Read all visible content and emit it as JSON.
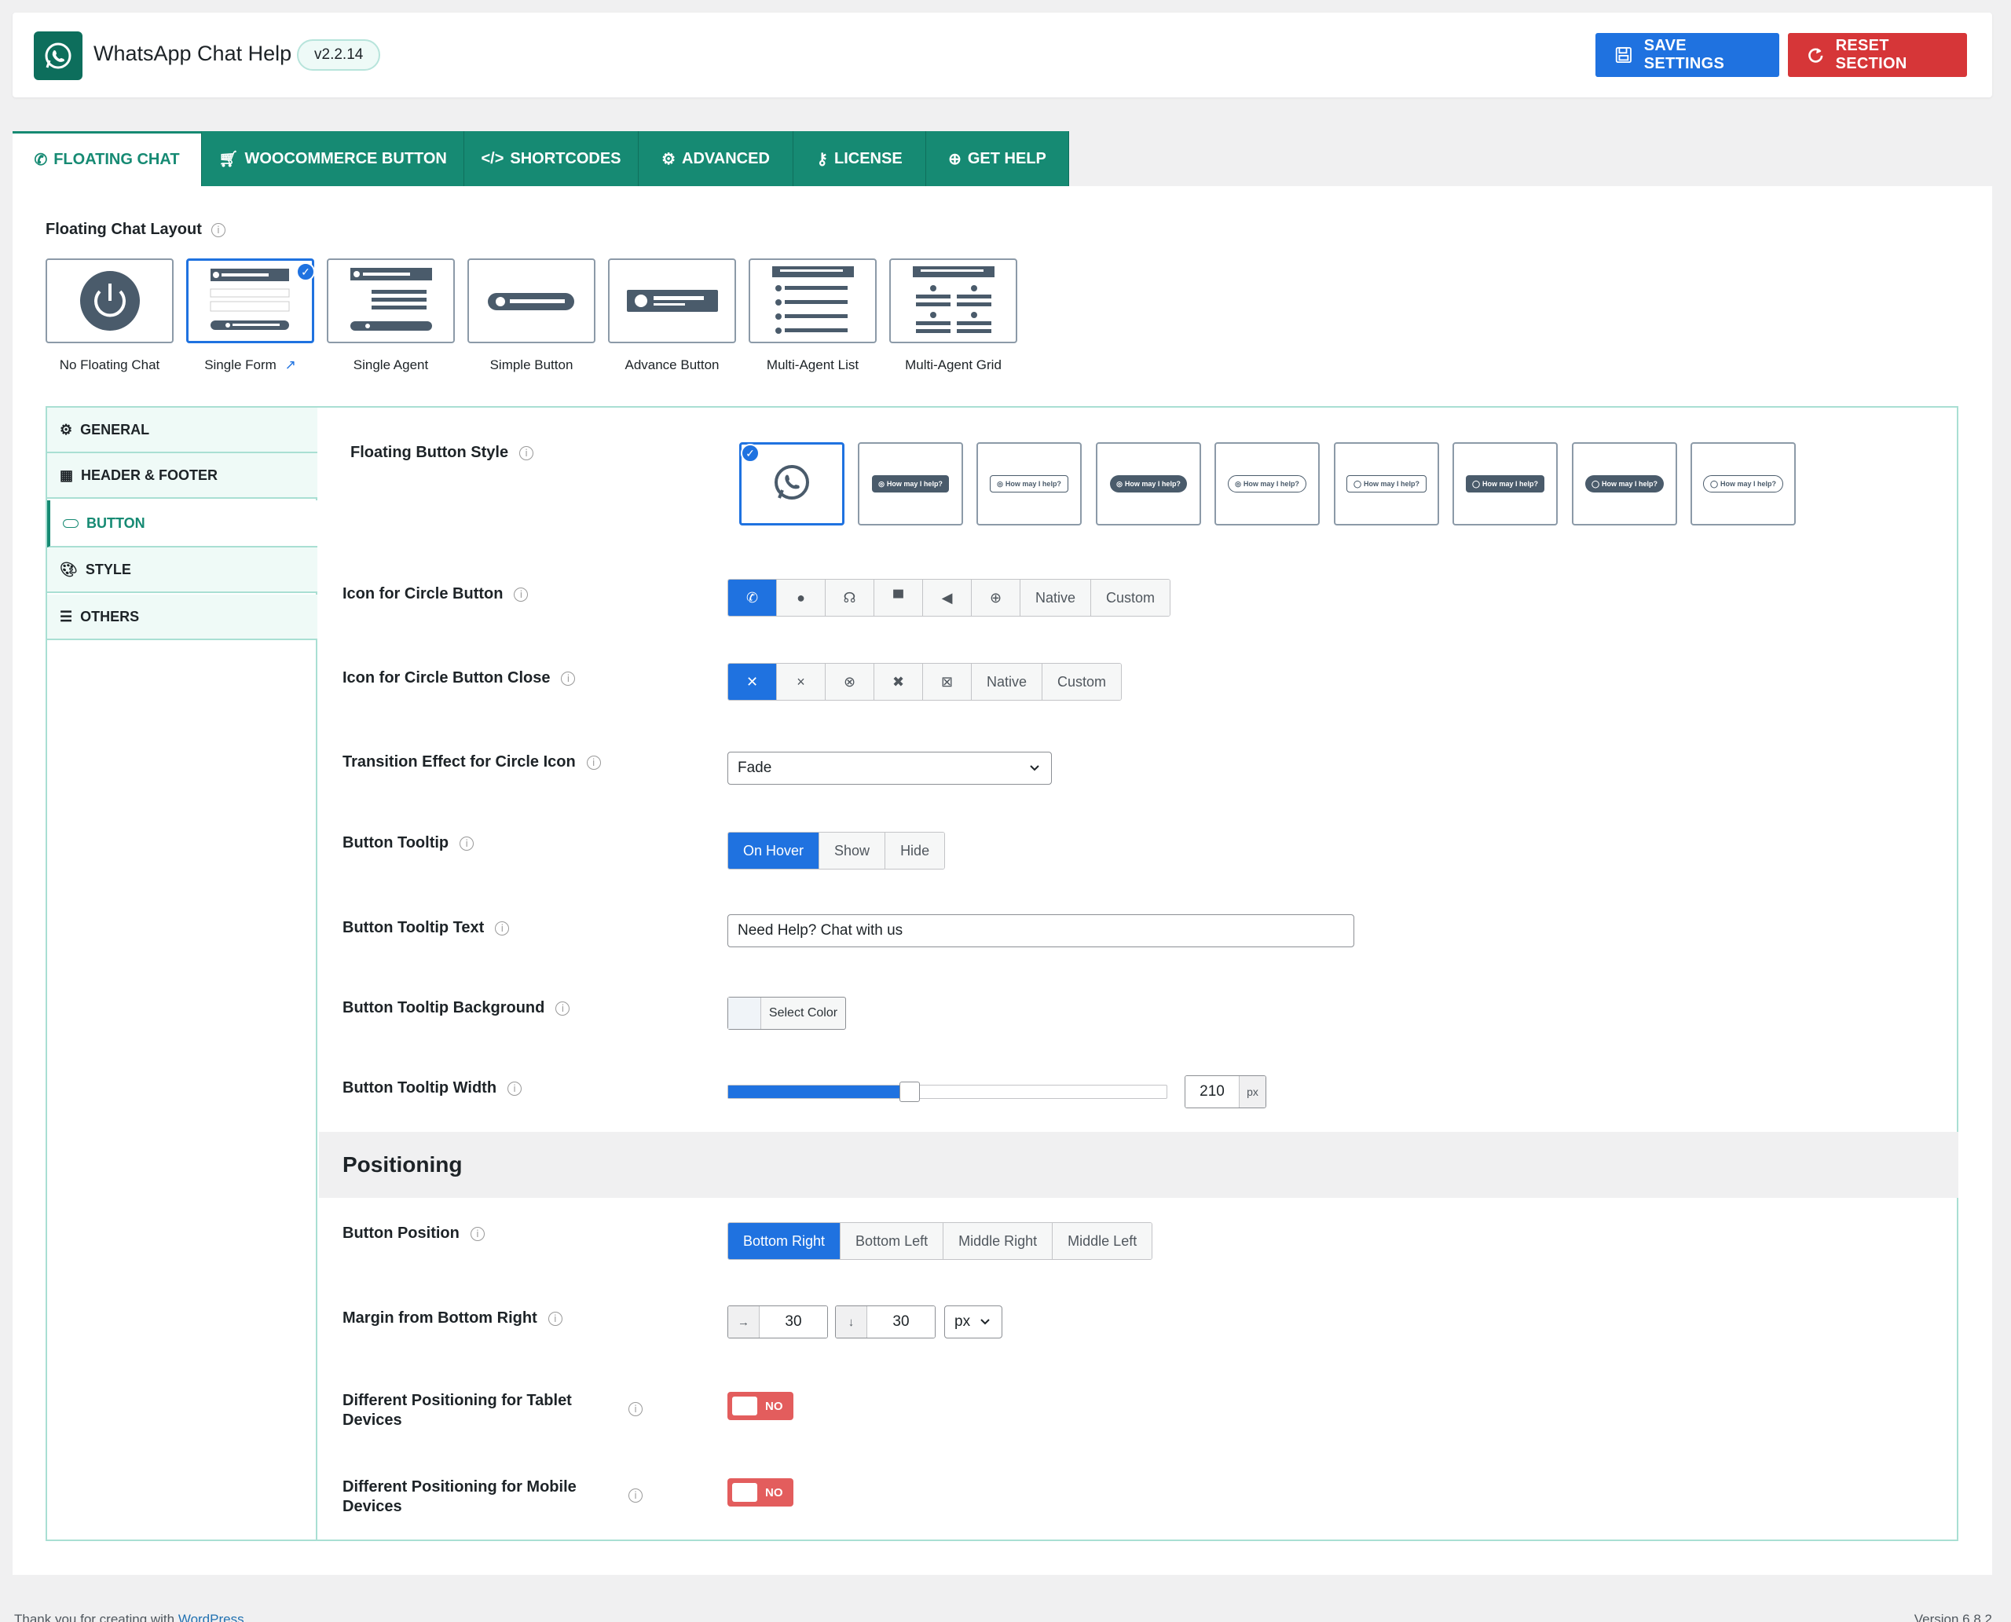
{
  "header": {
    "app_title": "WhatsApp Chat Help",
    "version": "v2.2.14",
    "save_label": "SAVE SETTINGS",
    "reset_label": "RESET SECTION",
    "save_color": "#1f72e0",
    "reset_color": "#d63638"
  },
  "tabs": [
    {
      "label": "FLOATING CHAT",
      "icon": "whatsapp-icon",
      "active": true
    },
    {
      "label": "WOOCOMMERCE BUTTON",
      "icon": "cart-icon"
    },
    {
      "label": "SHORTCODES",
      "icon": "code-icon"
    },
    {
      "label": "ADVANCED",
      "icon": "gears-icon"
    },
    {
      "label": "LICENSE",
      "icon": "key-icon"
    },
    {
      "label": "GET HELP",
      "icon": "lifebuoy-icon"
    }
  ],
  "layout": {
    "label": "Floating Chat Layout",
    "options": [
      {
        "name": "No Floating Chat"
      },
      {
        "name": "Single Form",
        "selected": true
      },
      {
        "name": "Single Agent"
      },
      {
        "name": "Simple Button"
      },
      {
        "name": "Advance Button"
      },
      {
        "name": "Multi-Agent List"
      },
      {
        "name": "Multi-Agent Grid"
      }
    ]
  },
  "sidebar": {
    "items": [
      {
        "label": "GENERAL",
        "icon": "gears-icon"
      },
      {
        "label": "HEADER & FOOTER",
        "icon": "table-icon"
      },
      {
        "label": "BUTTON",
        "icon": "button-shape-icon",
        "active": true
      },
      {
        "label": "STYLE",
        "icon": "palette-icon"
      },
      {
        "label": "OTHERS",
        "icon": "sliders-icon"
      }
    ]
  },
  "button_settings": {
    "floating_button_style": {
      "label": "Floating Button Style",
      "pill_text": "How may I help?"
    },
    "circle_icon": {
      "label": "Icon for Circle Button",
      "native": "Native",
      "custom": "Custom"
    },
    "circle_close": {
      "label": "Icon for Circle Button Close",
      "native": "Native",
      "custom": "Custom"
    },
    "transition": {
      "label": "Transition Effect for Circle Icon",
      "value": "Fade"
    },
    "tooltip": {
      "label": "Button Tooltip",
      "options": [
        "On Hover",
        "Show",
        "Hide"
      ],
      "selected": "On Hover"
    },
    "tooltip_text": {
      "label": "Button Tooltip Text",
      "value": "Need Help? Chat with us"
    },
    "tooltip_bg": {
      "label": "Button Tooltip Background",
      "button": "Select Color"
    },
    "tooltip_width": {
      "label": "Button Tooltip Width",
      "value": "210",
      "unit": "px",
      "slider_fraction": 0.39
    }
  },
  "positioning": {
    "title": "Positioning",
    "button_position": {
      "label": "Button Position",
      "options": [
        "Bottom Right",
        "Bottom Left",
        "Middle Right",
        "Middle Left"
      ],
      "selected": "Bottom Right"
    },
    "margin": {
      "label": "Margin from Bottom Right",
      "x": "30",
      "y": "30",
      "unit": "px",
      "x_arrow": "→",
      "y_arrow": "↓"
    },
    "tablet": {
      "label": "Different Positioning for Tablet Devices",
      "state": "NO"
    },
    "mobile": {
      "label": "Different Positioning for Mobile Devices",
      "state": "NO"
    }
  },
  "footer": {
    "thanks_prefix": "Thank you for creating with ",
    "thanks_link": "WordPress",
    "version": "Version 6.8.2"
  }
}
